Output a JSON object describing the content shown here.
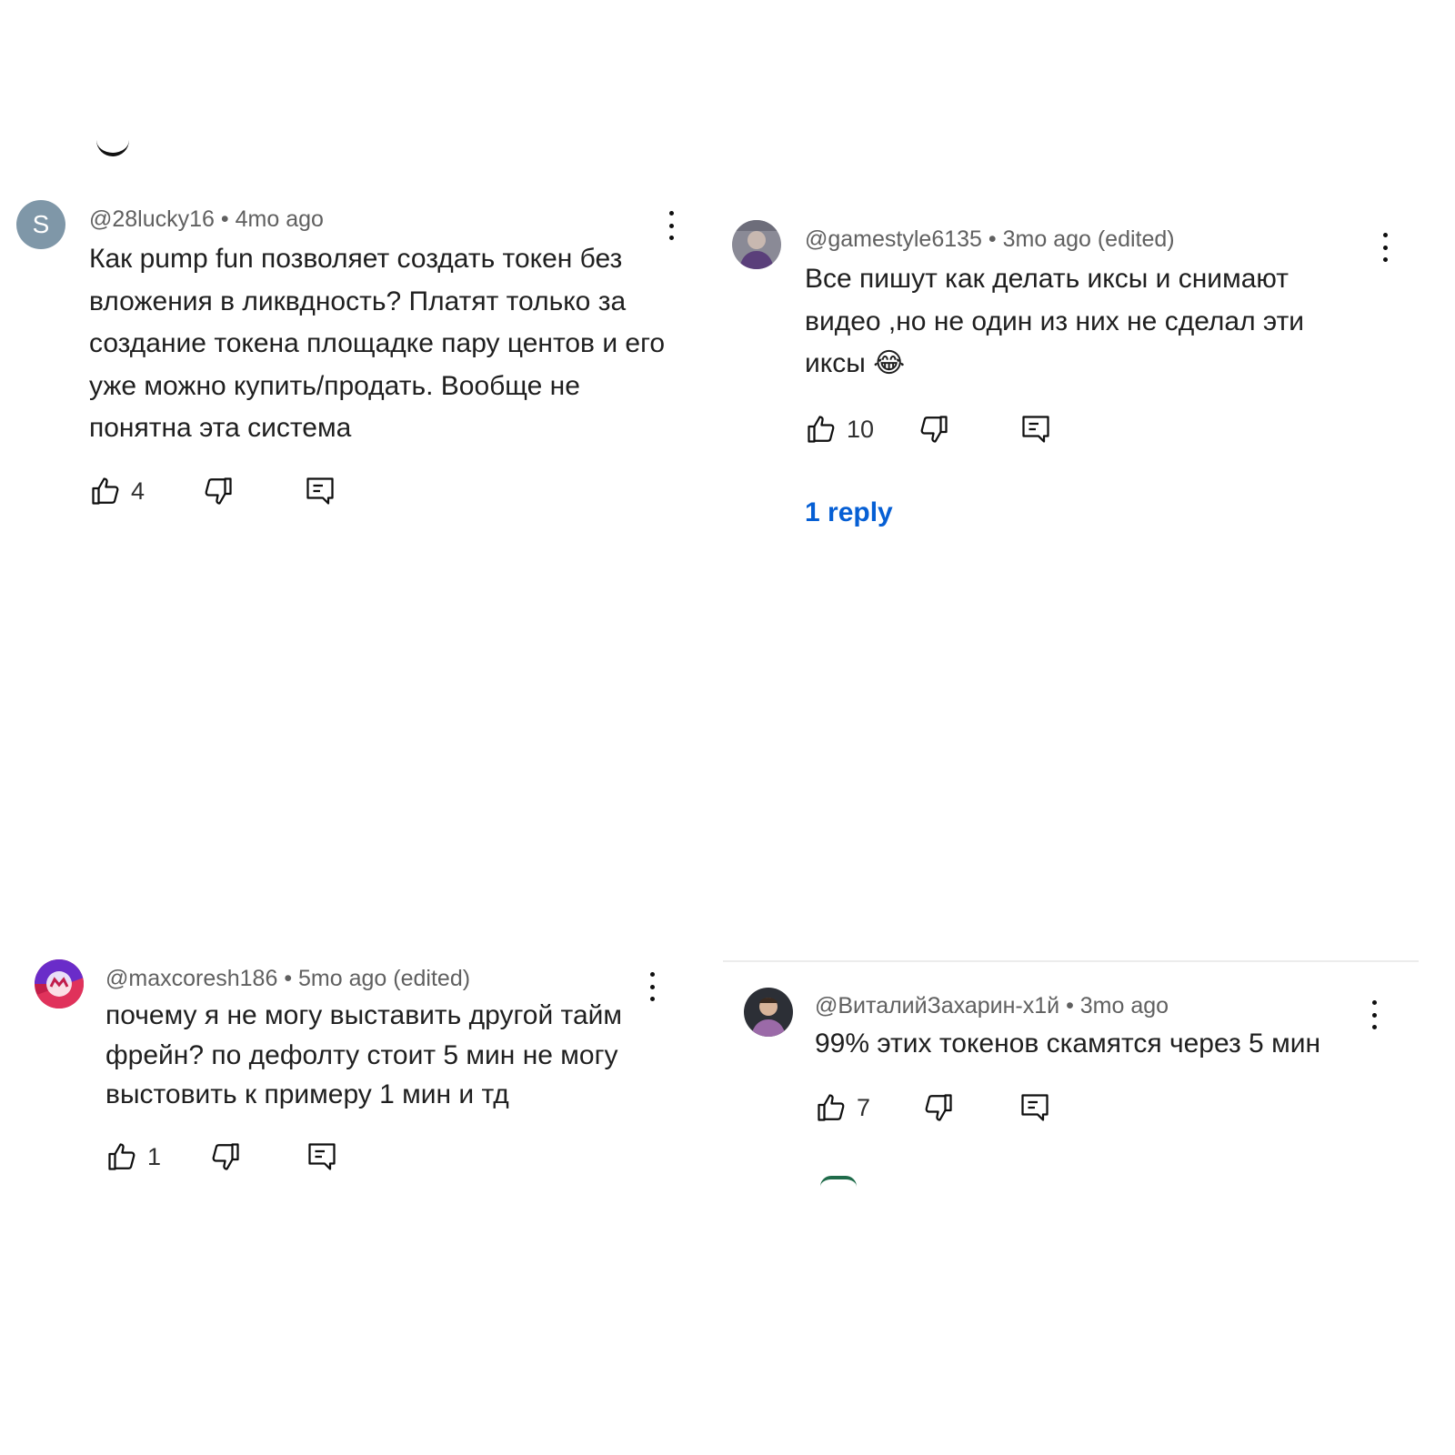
{
  "comments": [
    {
      "avatar_letter": "S",
      "author": "@28lucky16",
      "time": "4mo ago",
      "text": "Как pump fun позволяет создать токен без вложения в ликвдность? Платят только за создание токена площадке пару центов и его уже можно купить/продать. Вообще не понятна эта система",
      "likes": "4"
    },
    {
      "author": "@gamestyle6135",
      "time": "3mo ago",
      "edited": "(edited)",
      "text": "Все пишут как делать иксы и снимают видео ,но не один из них не сделал эти иксы 😂",
      "likes": "10",
      "replies_label": "1 reply"
    },
    {
      "author": "@maxcoresh186",
      "time": "5mo ago",
      "edited": "(edited)",
      "text": "почему я не могу выставить другой тайм фрейн? по дефолту стоит 5 мин не могу выстовить к примеру 1 мин и тд",
      "likes": "1"
    },
    {
      "author": "@ВиталийЗахарин-х1й",
      "time": "3mo ago",
      "text": "99% этих токенов скамятся через 5 мин",
      "likes": "7"
    }
  ],
  "separator": "•",
  "link_color": "#065fd4"
}
